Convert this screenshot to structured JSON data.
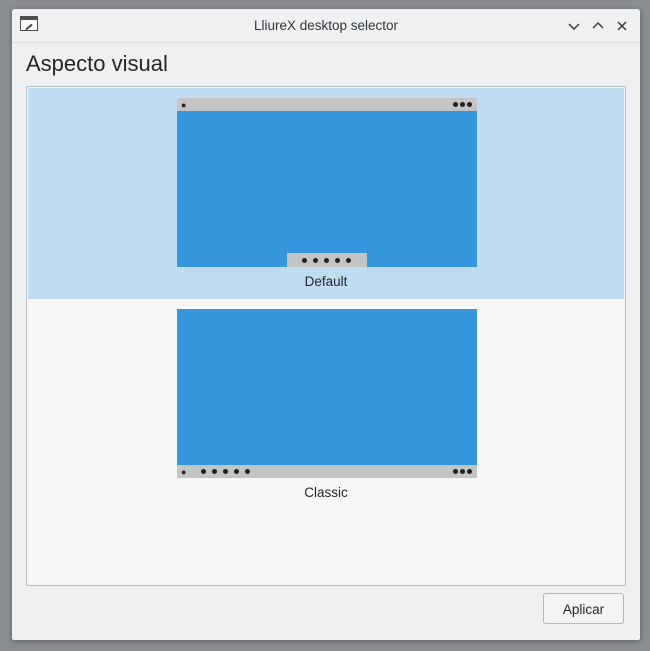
{
  "window": {
    "title": "LliureX desktop selector",
    "controls": [
      "minimize",
      "maximize",
      "close"
    ]
  },
  "heading": "Aspecto visual",
  "layouts": [
    {
      "label": "Default",
      "selected": true
    },
    {
      "label": "Classic",
      "selected": false
    }
  ],
  "apply_label": "Aplicar",
  "colors": {
    "selection": "#c0dcf0",
    "desktop": "#3596dc",
    "panel": "#c4c4c4"
  }
}
